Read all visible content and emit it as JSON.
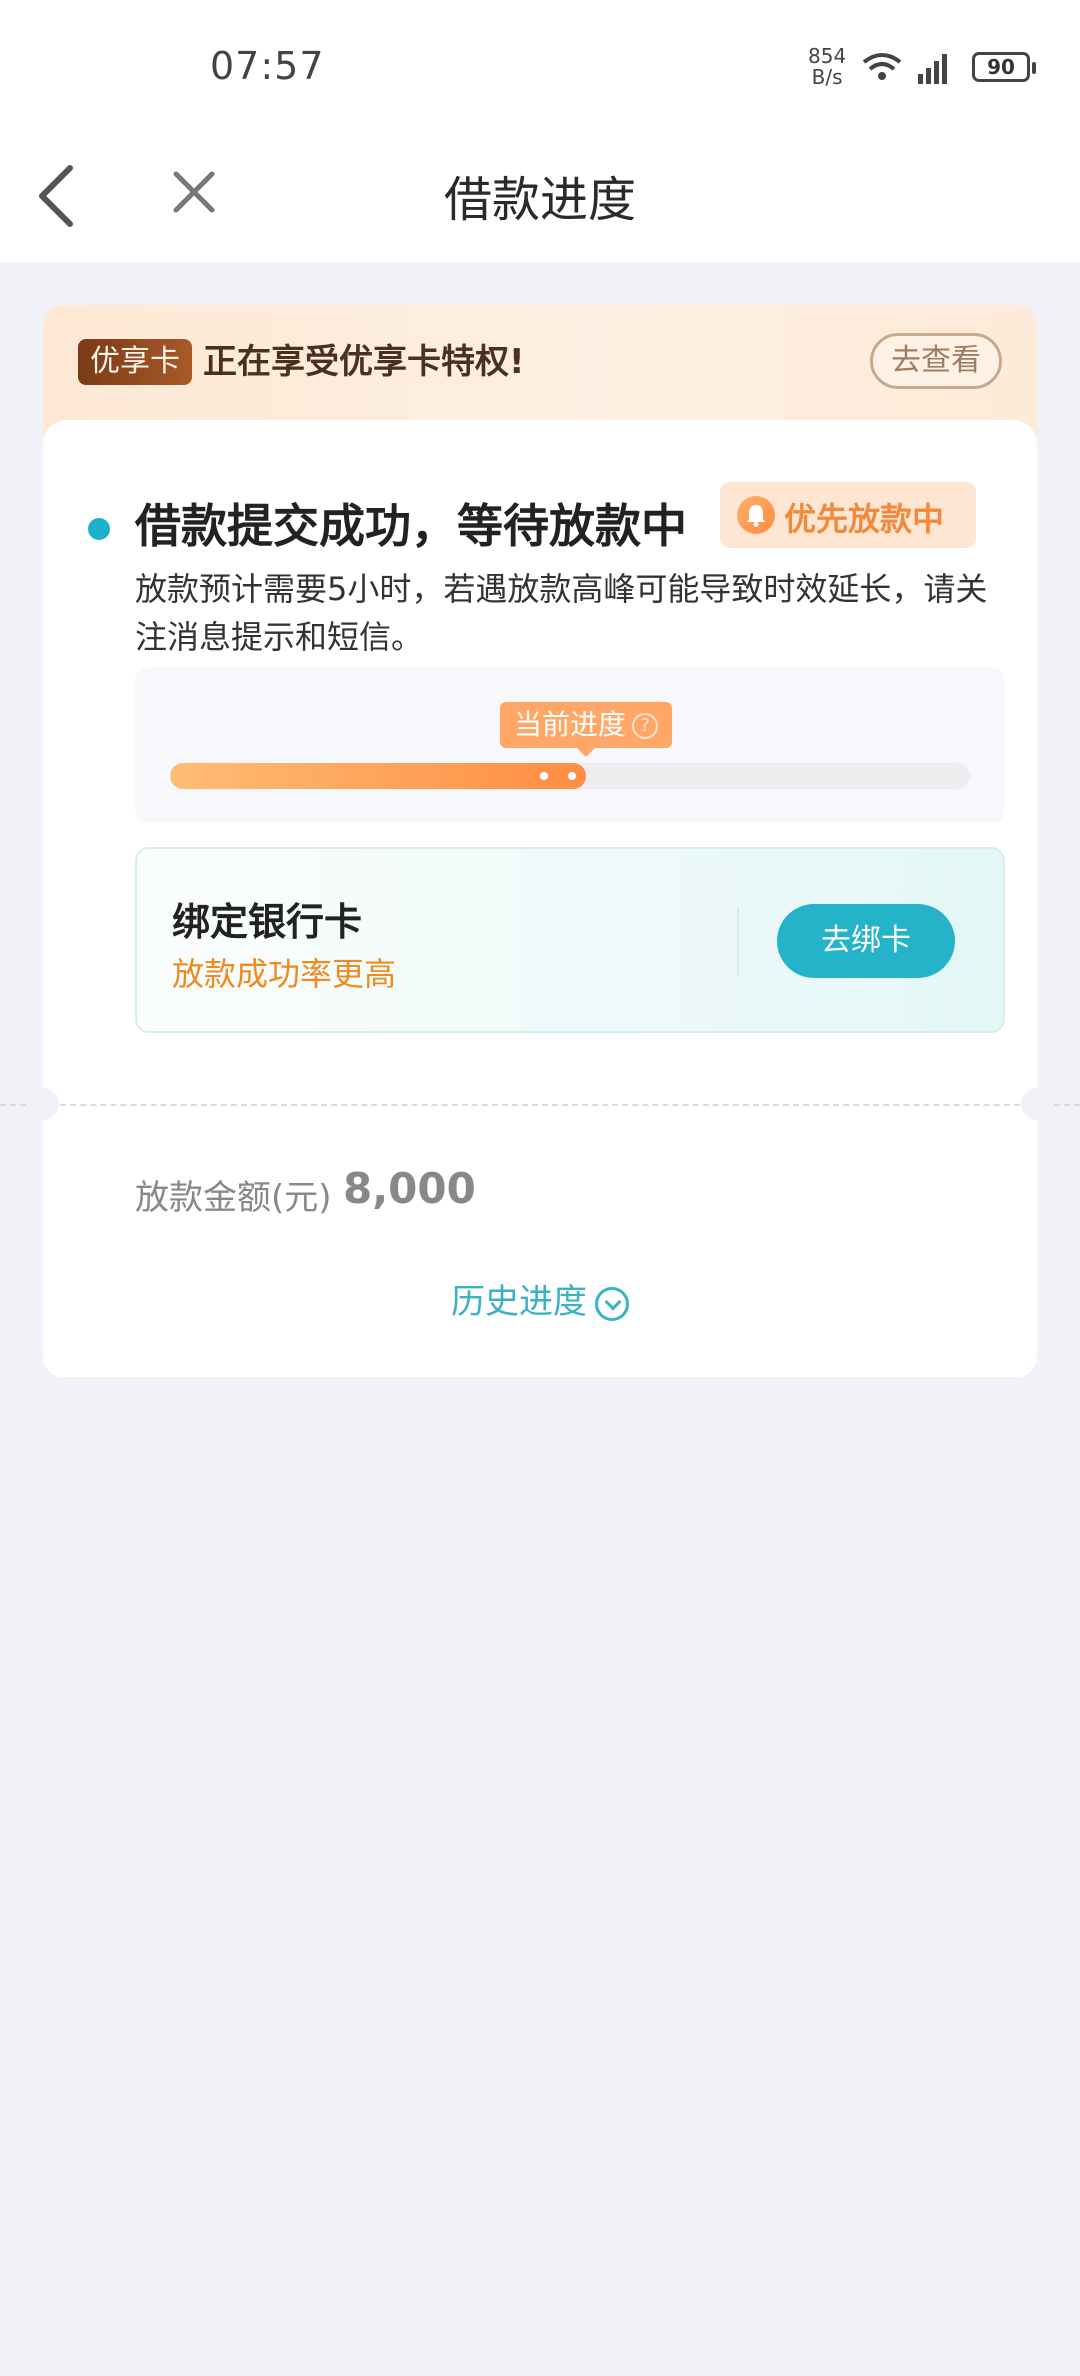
{
  "status_bar": {
    "time": "07:57",
    "net_speed_value": "854",
    "net_speed_unit": "B/s",
    "battery": "90"
  },
  "nav": {
    "title": "借款进度"
  },
  "banner": {
    "badge": "优享卡",
    "text": "正在享受优享卡特权!",
    "button": "去查看"
  },
  "loan_status": {
    "title": "借款提交成功，等待放款中",
    "priority_tag": "优先放款中",
    "description": "放款预计需要5小时，若遇放款高峰可能导致时效延长，请关注消息提示和短信。",
    "progress_label": "当前进度",
    "progress_help_icon": "?",
    "progress_fraction": 0.52
  },
  "bind_card": {
    "title": "绑定银行卡",
    "subtitle": "放款成功率更高",
    "button": "去绑卡"
  },
  "amount": {
    "label": "放款金额(元)",
    "value": "8,000"
  },
  "history": {
    "label": "历史进度"
  },
  "colors": {
    "accent": "#25b3c9",
    "orange": "#ff8e42",
    "page_bg": "#f0f2f7"
  }
}
